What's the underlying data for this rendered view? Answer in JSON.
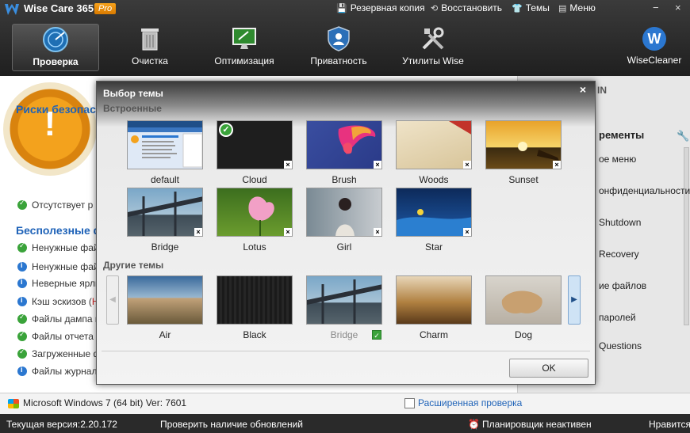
{
  "app": {
    "title": "Wise Care 365",
    "badge": "Pro",
    "top_menu": [
      {
        "icon": "save-icon",
        "label": "Резервная копия"
      },
      {
        "icon": "restore-icon",
        "label": "Восстановить"
      },
      {
        "icon": "shirt-icon",
        "label": "Темы"
      },
      {
        "icon": "menu-icon",
        "label": "Меню"
      }
    ],
    "window_controls": [
      "−",
      "×"
    ]
  },
  "nav": [
    {
      "icon": "radar-icon",
      "label": "Проверка",
      "active": true
    },
    {
      "icon": "trash-icon",
      "label": "Очистка",
      "active": false
    },
    {
      "icon": "monitor-icon",
      "label": "Оптимизация",
      "active": false
    },
    {
      "icon": "shield-icon",
      "label": "Приватность",
      "active": false
    },
    {
      "icon": "tools-icon",
      "label": "Утилиты Wise",
      "active": false
    }
  ],
  "brand": {
    "logo_letter": "W",
    "label": "WiseCleaner"
  },
  "main": {
    "risk_heading": "Риски безопасн",
    "risk_items": [
      {
        "status": "ok",
        "text": "Отсутствует р"
      }
    ],
    "junk_heading": "Бесполезные фай",
    "junk_items": [
      {
        "status": "ok",
        "text": "Ненужные файл",
        "extra": ""
      },
      {
        "status": "info",
        "text": "Ненужные файл",
        "extra": ""
      },
      {
        "status": "info",
        "text": "Неверные ярль",
        "extra": ""
      },
      {
        "status": "info",
        "text": "Кэш эскизов (",
        "extra": "Н"
      },
      {
        "status": "ok",
        "text": "Файлы дампа п",
        "extra": ""
      },
      {
        "status": "ok",
        "text": "Файлы отчета о",
        "extra": ""
      },
      {
        "status": "ok",
        "text": "Загруженные ф",
        "extra": ""
      },
      {
        "status": "info",
        "text": "Файлы журнала",
        "extra": ""
      }
    ]
  },
  "right_panel": {
    "heading_top": "IN",
    "heading": "ременты",
    "items": [
      "ое меню",
      "онфиденциальности",
      "Shutdown",
      "Recovery",
      "ие файлов",
      "паролей",
      "Questions"
    ]
  },
  "os_bar": {
    "text": "Microsoft Windows 7 (64 bit) Ver: 7601",
    "advanced": "Расширенная проверка"
  },
  "status_bar": {
    "version": "Текущая версия:2.20.172",
    "updates": "Проверить наличие обновлений",
    "scheduler": "Планировщик неактивен",
    "like": "Нравится"
  },
  "dialog": {
    "title": "Выбор темы",
    "close": "×",
    "builtin_label": "Встроенные",
    "builtin": [
      {
        "name": "default",
        "selected": false
      },
      {
        "name": "Cloud",
        "selected": true
      },
      {
        "name": "Brush",
        "selected": false
      },
      {
        "name": "Woods",
        "selected": false
      },
      {
        "name": "Sunset",
        "selected": false
      },
      {
        "name": "Bridge",
        "selected": false
      },
      {
        "name": "Lotus",
        "selected": false
      },
      {
        "name": "Girl",
        "selected": false
      },
      {
        "name": "Star",
        "selected": false
      }
    ],
    "other_label": "Другие темы",
    "other": [
      {
        "name": "Air",
        "installed": false
      },
      {
        "name": "Black",
        "installed": false
      },
      {
        "name": "Bridge",
        "installed": true
      },
      {
        "name": "Charm",
        "installed": false
      },
      {
        "name": "Dog",
        "installed": false
      }
    ],
    "delete_mark": "×",
    "ok": "OK"
  },
  "colors": {
    "accent": "#1f63b8",
    "ok": "#3aa33a",
    "info": "#2b77d0",
    "badge": "#f7a21b"
  }
}
